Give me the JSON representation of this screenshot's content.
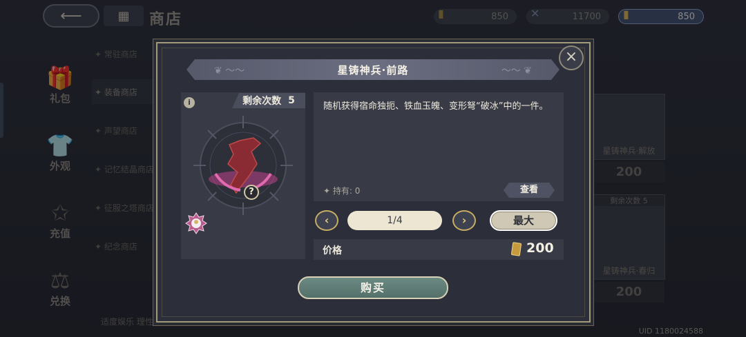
{
  "header": {
    "title": "商店",
    "back_icon": "back-arrow-icon",
    "home_icon": "grid-icon"
  },
  "currencies": [
    {
      "icon": "ticket-icon",
      "value": "850"
    },
    {
      "icon": "crossed-swords-icon",
      "value": "11700"
    },
    {
      "icon": "ticket-icon",
      "value": "850"
    }
  ],
  "sidebar": {
    "items": [
      {
        "label": "礼包",
        "icon": "gift-icon"
      },
      {
        "label": "外观",
        "icon": "outfit-icon"
      },
      {
        "label": "充值",
        "icon": "star-icon"
      },
      {
        "label": "兑换",
        "icon": "exchange-icon"
      }
    ]
  },
  "shop_menu": [
    {
      "label": "✦ 常驻商店",
      "active": false
    },
    {
      "label": "✦ 装备商店",
      "active": true
    },
    {
      "label": "✦ 声望商店",
      "active": false
    },
    {
      "label": "✦ 记忆结晶商店",
      "active": false
    },
    {
      "label": "✦ 征服之塔商店",
      "active": false
    },
    {
      "label": "✦ 纪念商店",
      "active": false
    }
  ],
  "footer_note": "适度娱乐 理性消费",
  "uid": "UID 1180024588",
  "bg_cards": [
    {
      "name": "星铸神兵·解放",
      "price": "200",
      "count": ""
    },
    {
      "name": "星铸神兵·春归",
      "price": "200",
      "count": "剩余次数 5"
    }
  ],
  "dialog": {
    "title": "星铸神兵·前路",
    "remaining_label": "剩余次数",
    "remaining_value": "5",
    "info_icon": "i",
    "item_badge": "?",
    "description": "随机获得宿命独扼、铁血玉魄、变形弩“破冰”中的一件。",
    "owned": "✦ 持有: 0",
    "view_label": "查看",
    "quantity": "1/4",
    "prev_icon": "‹",
    "next_icon": "›",
    "max_label": "最大",
    "price_label": "价格",
    "price_value": "200",
    "buy_label": "购买",
    "close_icon": "×"
  },
  "colors": {
    "accent_gold": "#c7ad63",
    "buy_green": "#5e7c75",
    "panel": "#383b46"
  }
}
